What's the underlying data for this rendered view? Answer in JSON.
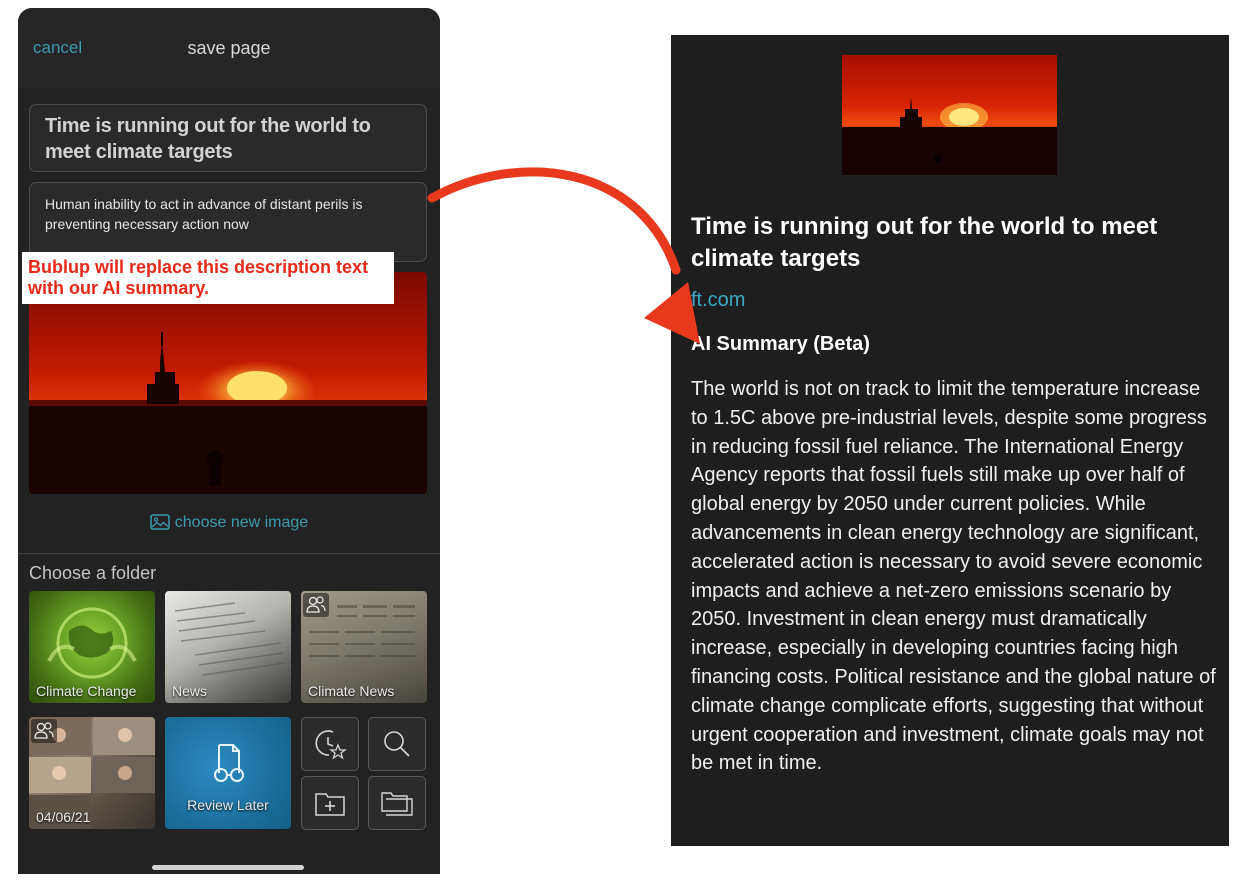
{
  "left_panel": {
    "cancel_label": "cancel",
    "header_title": "save page",
    "page_title": "Time is running out for the world to meet climate targets",
    "description": "Human inability to act in advance of distant perils is preventing necessary action now",
    "choose_image_label": "choose new image",
    "folder_heading": "Choose a folder",
    "folders": [
      {
        "label": "Climate Change"
      },
      {
        "label": "News"
      },
      {
        "label": "Climate News",
        "shared": true
      },
      {
        "label": "04/06/21",
        "shared": true
      },
      {
        "label": "Review Later"
      }
    ],
    "quick_actions": [
      "recent-clock-icon",
      "search-icon",
      "new-folder-icon",
      "folders-icon"
    ]
  },
  "annotation": {
    "text": "Bublup will replace this description text with our AI summary.",
    "color": "#e8291a"
  },
  "right_panel": {
    "title": "Time is running out for the world to meet climate targets",
    "source": "ft.com",
    "summary_heading": "AI Summary (Beta)",
    "summary": "The world is not on track to limit the temperature increase to 1.5C above pre-industrial levels, despite some progress in reducing fossil fuel reliance. The International Energy Agency reports that fossil fuels still make up over half of global energy by 2050 under current policies. While advancements in clean energy technology are significant, accelerated action is necessary to avoid severe economic impacts and achieve a net-zero emissions scenario by 2050. Investment in clean energy must dramatically increase, especially in developing countries facing high financing costs. Political resistance and the global nature of climate change complicate efforts, suggesting that without urgent cooperation and investment, climate goals may not be met in time."
  },
  "colors": {
    "accent_link": "#3d9bb0",
    "source_link": "#3da8c7",
    "annotation_red": "#e8291a",
    "panel_bg": "#1e1e1e"
  }
}
